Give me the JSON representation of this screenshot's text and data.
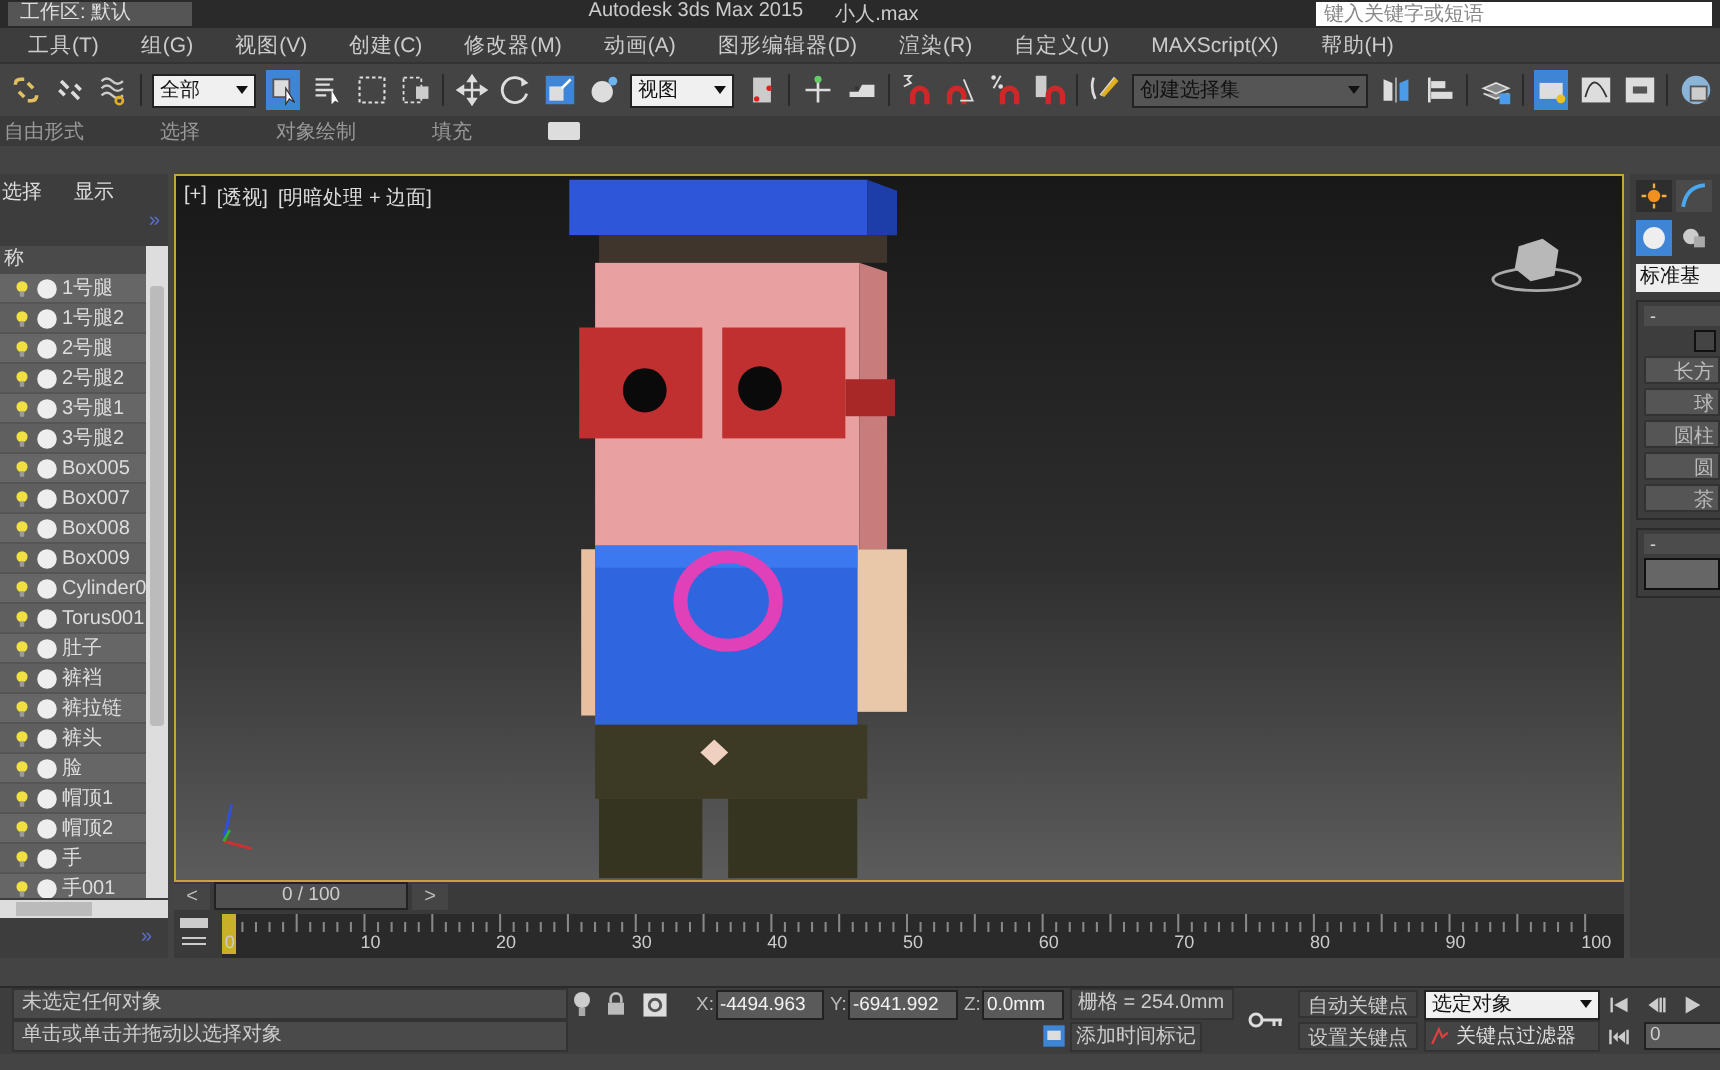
{
  "title_bar": {
    "workspace": "工作区: 默认",
    "title": "Autodesk 3ds Max  2015",
    "file": "小人.max",
    "search": {
      "placeholder": "键入关键字或短语"
    }
  },
  "menu_bar": [
    "工具(T)",
    "组(G)",
    "视图(V)",
    "创建(C)",
    "修改器(M)",
    "动画(A)",
    "图形编辑器(D)",
    "渲染(R)",
    "自定义(U)",
    "MAXScript(X)",
    "帮助(H)"
  ],
  "toolbar": {
    "items": [
      {
        "kind": "button",
        "selected": false
      },
      {
        "kind": "button",
        "selected": false
      },
      {
        "kind": "button",
        "selected": false
      },
      {
        "kind": "separator"
      },
      {
        "kind": "dropdown",
        "value": "全部"
      },
      {
        "kind": "button",
        "selected": true
      },
      {
        "kind": "button",
        "selected": false
      },
      {
        "kind": "button",
        "selected": false
      },
      {
        "kind": "button",
        "selected": false
      },
      {
        "kind": "separator"
      },
      {
        "kind": "button",
        "selected": false
      },
      {
        "kind": "button",
        "selected": false
      },
      {
        "kind": "button",
        "selected": false
      },
      {
        "kind": "button",
        "selected": false
      },
      {
        "kind": "dropdown",
        "value": "视图"
      },
      {
        "kind": "button",
        "selected": false
      },
      {
        "kind": "separator"
      },
      {
        "kind": "button",
        "selected": false
      },
      {
        "kind": "button",
        "selected": false
      },
      {
        "kind": "separator"
      },
      {
        "kind": "button",
        "selected": false
      },
      {
        "kind": "button",
        "selected": false
      },
      {
        "kind": "button",
        "selected": false
      },
      {
        "kind": "button",
        "selected": false
      },
      {
        "kind": "separator"
      },
      {
        "kind": "button",
        "selected": false
      },
      {
        "kind": "dropdown",
        "value": "创建选择集"
      },
      {
        "kind": "button",
        "selected": false
      },
      {
        "kind": "button",
        "selected": false
      },
      {
        "kind": "separator"
      },
      {
        "kind": "button",
        "selected": false
      },
      {
        "kind": "separator"
      },
      {
        "kind": "button",
        "selected": true
      },
      {
        "kind": "button",
        "selected": false
      },
      {
        "kind": "button",
        "selected": false
      },
      {
        "kind": "separator"
      },
      {
        "kind": "button",
        "selected": false
      }
    ]
  },
  "ribbon_tabs": [
    "自由形式",
    "选择",
    "对象绘制",
    "填充"
  ],
  "scene_explorer": {
    "tabs": [
      {
        "label": "选择",
        "selected": false
      },
      {
        "label": "显示",
        "selected": false
      }
    ],
    "expand_toggles": [
      "»",
      "»"
    ],
    "column_header": "称",
    "items": [
      "1号腿",
      "1号腿2",
      "2号腿",
      "2号腿2",
      "3号腿1",
      "3号腿2",
      "Box005",
      "Box007",
      "Box008",
      "Box009",
      "Cylinder0",
      "Torus001",
      "肚子",
      "裤裆",
      "裤拉链",
      "裤头",
      "脸",
      "帽顶1",
      "帽顶2",
      "手",
      "手001"
    ]
  },
  "viewport": {
    "labels": [
      "[+]",
      "[透视]",
      "[明暗处理 + 边面]"
    ]
  },
  "command_panel": {
    "tabs": [
      {
        "selected": true
      },
      {
        "selected": false
      }
    ],
    "categories": [
      {
        "selected": true
      },
      {
        "selected": false
      }
    ],
    "object_type": "标准基",
    "rollout_toggles": [
      "-",
      "-"
    ],
    "checkbox": {
      "checked": false
    },
    "buttons": [
      "长方",
      "球",
      "圆柱",
      "圆",
      "茶"
    ]
  },
  "time_slider": {
    "prev": "<",
    "position": "0 / 100",
    "next": ">"
  },
  "track_bar": {
    "ticks": [
      "0",
      "10",
      "20",
      "30",
      "40",
      "50",
      "60",
      "70",
      "80",
      "90",
      "100"
    ]
  },
  "status_bar": {
    "prompt": "未选定任何对象",
    "hint": "单击或单击并拖动以选择对象",
    "x": {
      "label": "X:",
      "value": "-4494.963"
    },
    "y": {
      "label": "Y:",
      "value": "-6941.992"
    },
    "z": {
      "label": "Z:",
      "value": "0.0mm"
    },
    "grid": "栅格 = 254.0mm",
    "time_tag": "添加时间标记",
    "auto_key": "自动关键点",
    "key_target": "选定对象",
    "set_key": "设置关键点",
    "key_filters": "关键点过滤器",
    "frame": "0"
  }
}
